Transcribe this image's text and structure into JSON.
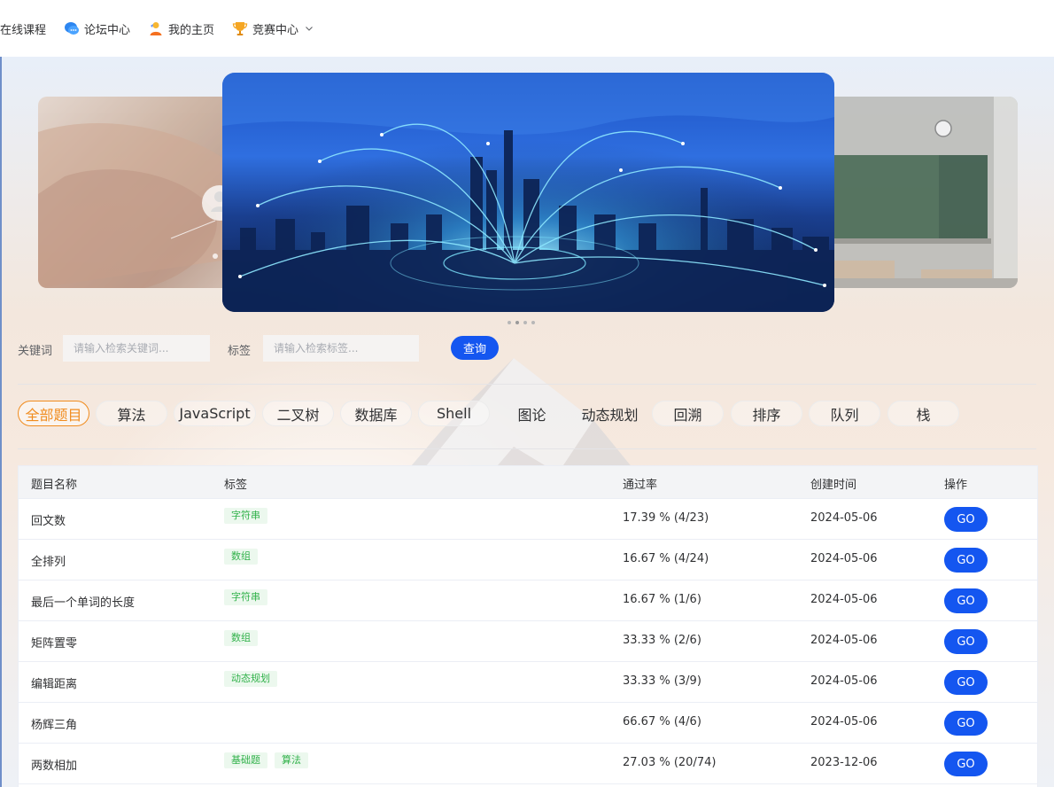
{
  "nav": {
    "items": [
      {
        "label": "在线课程",
        "icon": ""
      },
      {
        "label": "论坛中心",
        "icon": "chat-bubbles-icon"
      },
      {
        "label": "我的主页",
        "icon": "user-icon"
      },
      {
        "label": "竞赛中心",
        "icon": "trophy-icon",
        "dropdown": true
      }
    ]
  },
  "carousel": {
    "slides": [
      "classroom-hand-slide",
      "city-network-slide",
      "classroom-blackboard-slide"
    ],
    "active_index": 1,
    "dot_count": 4
  },
  "search": {
    "keyword_label": "关键词",
    "keyword_placeholder": "请输入检索关键词...",
    "tag_label": "标签",
    "tag_placeholder": "请输入检索标签...",
    "query_button": "查询"
  },
  "tags": {
    "items": [
      "全部题目",
      "算法",
      "JavaScript",
      "二叉树",
      "数据库",
      "Shell",
      "图论",
      "动态规划",
      "回溯",
      "排序",
      "队列",
      "栈"
    ],
    "active_index": 0
  },
  "table": {
    "headers": {
      "name": "题目名称",
      "tags": "标签",
      "pass_rate": "通过率",
      "created": "创建时间",
      "action": "操作"
    },
    "go_label": "GO",
    "rows": [
      {
        "name": "回文数",
        "tags": [
          "字符串"
        ],
        "pass_rate": "17.39 % (4/23)",
        "created": "2024-05-06"
      },
      {
        "name": "全排列",
        "tags": [
          "数组"
        ],
        "pass_rate": "16.67 % (4/24)",
        "created": "2024-05-06"
      },
      {
        "name": "最后一个单词的长度",
        "tags": [
          "字符串"
        ],
        "pass_rate": "16.67 % (1/6)",
        "created": "2024-05-06"
      },
      {
        "name": "矩阵置零",
        "tags": [
          "数组"
        ],
        "pass_rate": "33.33 % (2/6)",
        "created": "2024-05-06"
      },
      {
        "name": "编辑距离",
        "tags": [
          "动态规划"
        ],
        "pass_rate": "33.33 % (3/9)",
        "created": "2024-05-06"
      },
      {
        "name": "杨辉三角",
        "tags": [],
        "pass_rate": "66.67 % (4/6)",
        "created": "2024-05-06"
      },
      {
        "name": "两数相加",
        "tags": [
          "基础题",
          "算法"
        ],
        "pass_rate": "27.03 % (20/74)",
        "created": "2023-12-06"
      }
    ]
  },
  "colors": {
    "accent": "#1456f0",
    "active_tag": "#f08c1f",
    "chip_text": "#32b24b",
    "chip_bg": "#ecf8ee"
  }
}
